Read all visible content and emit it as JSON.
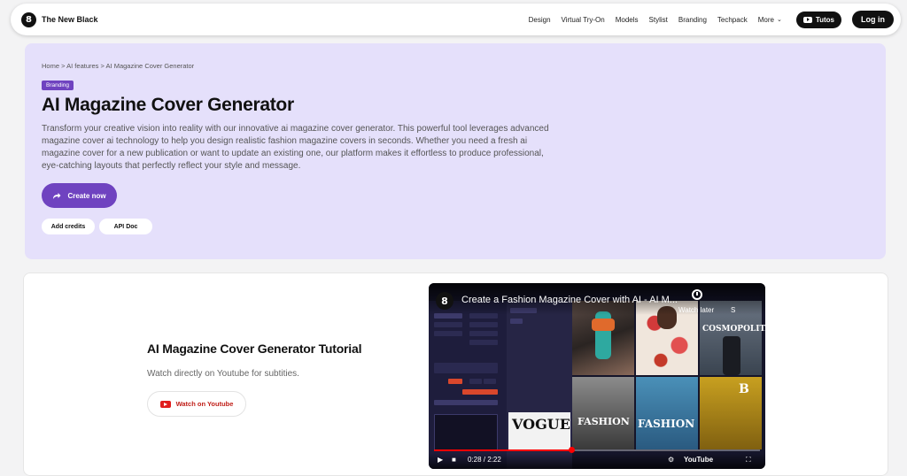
{
  "nav": {
    "brand": "The New Black",
    "brand_logo_letter": "8",
    "links": [
      "Design",
      "Virtual Try-On",
      "Models",
      "Stylist",
      "Branding",
      "Techpack"
    ],
    "more_label": "More",
    "tutos_label": "Tutos",
    "login_label": "Log in"
  },
  "hero": {
    "breadcrumb": "Home > AI features > AI Magazine Cover Generator",
    "badge": "Branding",
    "title": "AI Magazine Cover Generator",
    "description": "Transform your creative vision into reality with our innovative ai magazine cover generator. This powerful tool leverages advanced magazine cover ai technology to help you design realistic fashion magazine covers in seconds. Whether you need a fresh ai magazine cover for a new publication or want to update an existing one, our platform makes it effortless to produce professional, eye-catching layouts that perfectly reflect your style and message.",
    "create_label": "Create now",
    "credits_label": "Add credits",
    "api_label": "API Doc"
  },
  "tutorial": {
    "title": "AI Magazine Cover Generator Tutorial",
    "subtitle": "Watch directly on Youtube for subtities.",
    "youtube_button": "Watch on Youtube",
    "video": {
      "title": "Create a Fashion Magazine Cover with AI - AI M...",
      "logo_letter": "8",
      "watch_later": "Watch later",
      "share_initial": "S",
      "cover_texts": [
        "COSMOPOLITAN",
        "FASHION",
        "VOGUE",
        "FASHION",
        "B"
      ],
      "time": "0:28 / 2:22",
      "brand": "YouTube",
      "progress": 0.42
    }
  },
  "colors": {
    "accent": "#6f43c0",
    "hero_bg": "#e5e0fb",
    "youtube_red": "#e01e1e"
  }
}
